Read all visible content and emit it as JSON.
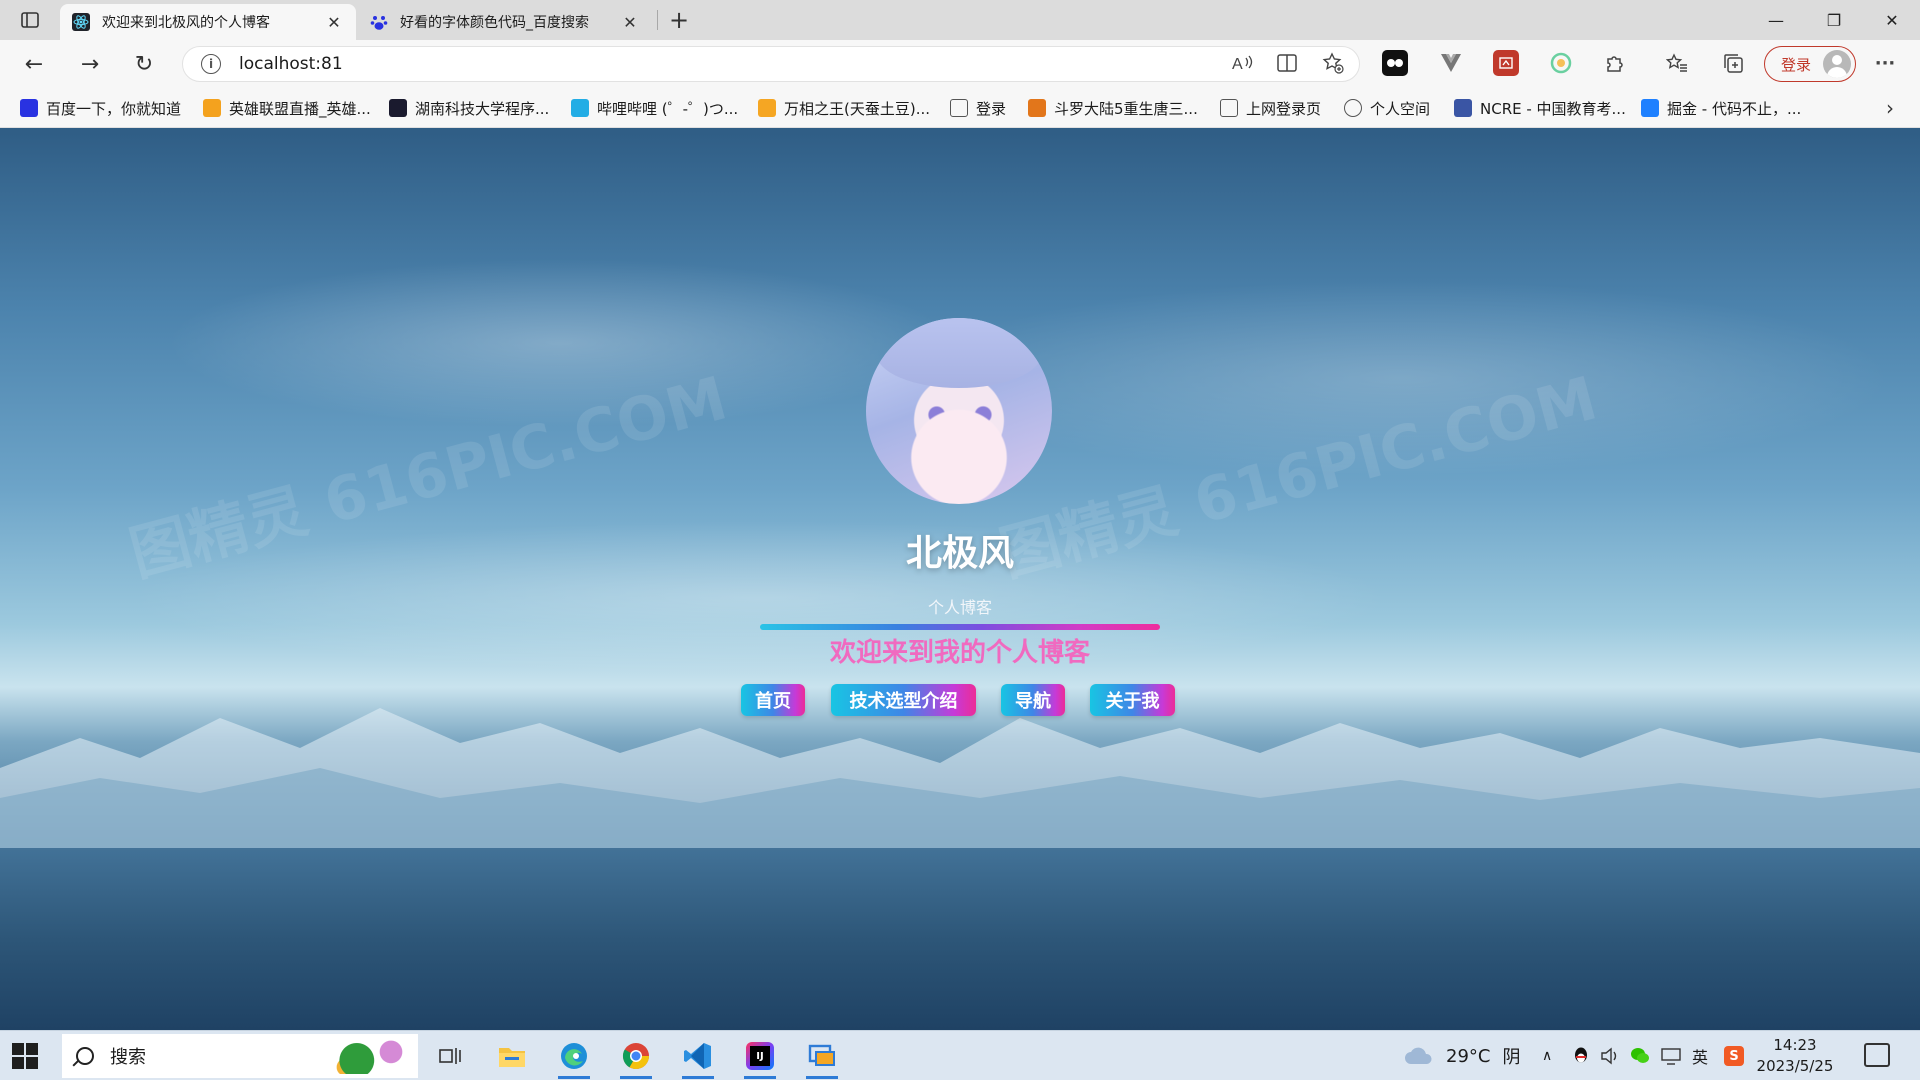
{
  "browser": {
    "tabs": [
      {
        "title": "欢迎来到北极风的个人博客",
        "active": true,
        "favicon": "react-icon"
      },
      {
        "title": "好看的字体颜色代码_百度搜索",
        "active": false,
        "favicon": "baidu-paw-icon"
      }
    ],
    "new_tab": "+",
    "window_controls": {
      "minimize": "—",
      "restore": "❐",
      "close": "✕"
    },
    "address": {
      "url": "localhost:81"
    },
    "nav": {
      "back": "←",
      "forward": "→",
      "reload": "↻"
    },
    "toolbar_icons": [
      "read-aloud-icon",
      "split-screen-icon",
      "add-favorite-icon"
    ],
    "extensions": [
      "ext-tampermonkey-icon",
      "ext-vue-icon",
      "ext-red-icon",
      "ext-green-circle-icon",
      "extensions-puzzle-icon",
      "favorites-icon",
      "collections-icon"
    ],
    "signin_label": "登录",
    "more_menu": "···",
    "bookmarks": [
      {
        "label": "百度一下，你就知道",
        "icon": "baidu-paw-icon",
        "color": "#2932e1"
      },
      {
        "label": "英雄联盟直播_英雄...",
        "icon": "huya-icon",
        "color": "#f4a21e"
      },
      {
        "label": "湖南科技大学程序...",
        "icon": "dark-site-icon",
        "color": "#1a1a2e"
      },
      {
        "label": "哔哩哔哩 (゜-゜)つ...",
        "icon": "bilibili-icon",
        "color": "#23ade5"
      },
      {
        "label": "万相之王(天蚕土豆)...",
        "icon": "book-icon",
        "color": "#f5a623"
      },
      {
        "label": "登录",
        "icon": "page-icon",
        "color": "#555555"
      },
      {
        "label": "斗罗大陆5重生唐三...",
        "icon": "novel-icon",
        "color": "#e2761b"
      },
      {
        "label": "上网登录页",
        "icon": "page-icon",
        "color": "#555555"
      },
      {
        "label": "个人空间",
        "icon": "globe-icon",
        "color": "#555555"
      },
      {
        "label": "NCRE - 中国教育考...",
        "icon": "ncre-icon",
        "color": "#3a55a4"
      },
      {
        "label": "掘金 - 代码不止，...",
        "icon": "juejin-icon",
        "color": "#1e80ff"
      }
    ]
  },
  "blog": {
    "author": "北极风",
    "subtitle": "个人博客",
    "welcome": "欢迎来到我的个人博客",
    "nav": [
      "首页",
      "技术选型介绍",
      "导航",
      "关于我"
    ],
    "watermark": "图精灵 616PIC.COM",
    "accent": "#f06ac0"
  },
  "taskbar": {
    "search_placeholder": "搜索",
    "apps": [
      "task-view-icon",
      "file-explorer-icon",
      "edge-icon",
      "chrome-icon",
      "vscode-icon",
      "intellij-icon",
      "remote-desktop-icon"
    ],
    "weather": {
      "temp": "29°C",
      "condition": "阴"
    },
    "ime": "英",
    "time": "14:23",
    "date": "2023/5/25"
  }
}
